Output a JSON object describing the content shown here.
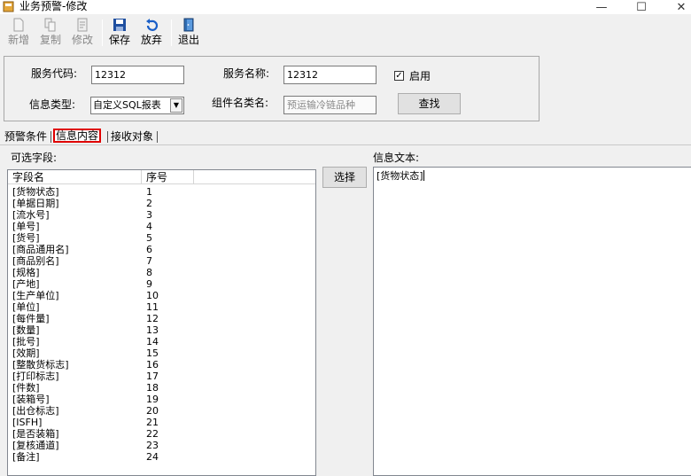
{
  "window": {
    "title": "业务预警-修改",
    "controls": {
      "minimize": "—",
      "maximize": "☐",
      "close": "✕"
    }
  },
  "toolbar": {
    "new_label": "新增",
    "copy_label": "复制",
    "edit_label": "修改",
    "save_label": "保存",
    "discard_label": "放弃",
    "exit_label": "退出"
  },
  "form": {
    "service_code_label": "服务代码:",
    "service_code_value": "12312",
    "service_name_label": "服务名称:",
    "service_name_value": "12312",
    "enabled_label": "启用",
    "enabled_checked": true,
    "info_type_label": "信息类型:",
    "info_type_value": "自定义SQL报表",
    "component_class_label": "组件名类名:",
    "component_class_value": "预运输冷链品种",
    "search_button": "查找"
  },
  "tabs": [
    {
      "label": "预警条件",
      "active": false
    },
    {
      "label": "信息内容",
      "active": true
    },
    {
      "label": "接收对象",
      "active": false
    }
  ],
  "fields_panel": {
    "label": "可选字段:",
    "columns": [
      "字段名",
      "序号"
    ],
    "rows": [
      [
        "[货物状态]",
        "1"
      ],
      [
        "[单据日期]",
        "2"
      ],
      [
        "[流水号]",
        "3"
      ],
      [
        "[单号]",
        "4"
      ],
      [
        "[货号]",
        "5"
      ],
      [
        "[商品通用名]",
        "6"
      ],
      [
        "[商品别名]",
        "7"
      ],
      [
        "[规格]",
        "8"
      ],
      [
        "[产地]",
        "9"
      ],
      [
        "[生产单位]",
        "10"
      ],
      [
        "[单位]",
        "11"
      ],
      [
        "[每件量]",
        "12"
      ],
      [
        "[数量]",
        "13"
      ],
      [
        "[批号]",
        "14"
      ],
      [
        "[效期]",
        "15"
      ],
      [
        "[整散货标志]",
        "16"
      ],
      [
        "[打印标志]",
        "17"
      ],
      [
        "[件数]",
        "18"
      ],
      [
        "[装箱号]",
        "19"
      ],
      [
        "[出仓标志]",
        "20"
      ],
      [
        "[ISFH]",
        "21"
      ],
      [
        "[是否装箱]",
        "22"
      ],
      [
        "[复核通道]",
        "23"
      ],
      [
        "[备注]",
        "24"
      ]
    ]
  },
  "select_button": "选择",
  "info_text": {
    "label": "信息文本:",
    "value": "[货物状态]"
  },
  "colors": {
    "background": "#f0f0f0",
    "active_tab_border": "#e00000",
    "save_icon": "#1f4fa0",
    "discard_icon": "#1a5fc8"
  }
}
